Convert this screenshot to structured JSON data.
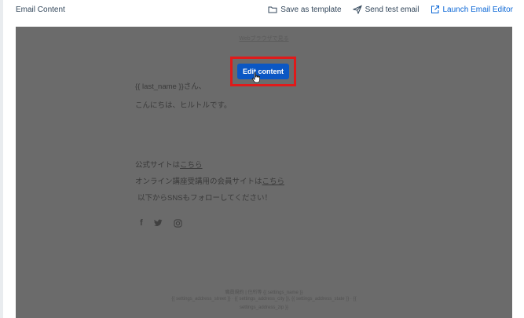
{
  "header": {
    "title": "Email Content",
    "save_template": "Save as template",
    "send_test": "Send test email",
    "launch_editor": "Launch Email Editor"
  },
  "preview": {
    "browser_link": "Webブラウザで見る",
    "edit_button": "Edit content",
    "greeting": "{{ last_name }}さん、",
    "intro": "こんにちは、ヒルトルです。",
    "site_prefix": "公式サイトは",
    "site_link": "こちら",
    "member_prefix": "オンライン講座受講用の会員サイトは",
    "member_link": "こちら",
    "follow": "以下からSNSもフォローしてください！",
    "social_icons": [
      "facebook-icon",
      "twitter-icon",
      "instagram-icon"
    ],
    "footer_line1": "職員規約 | 住所等 {{ settings_name }}",
    "footer_line2": "{{ settings_address_street }} · {{ settings_address_city }}, {{ settings_address_state }} · {{",
    "footer_line3": "settings_address_zip }}"
  },
  "colors": {
    "accent": "#0b67d6",
    "edit_button": "#0b57c4",
    "highlight_border": "#e01a1a",
    "overlay": "#6b6b6b"
  }
}
